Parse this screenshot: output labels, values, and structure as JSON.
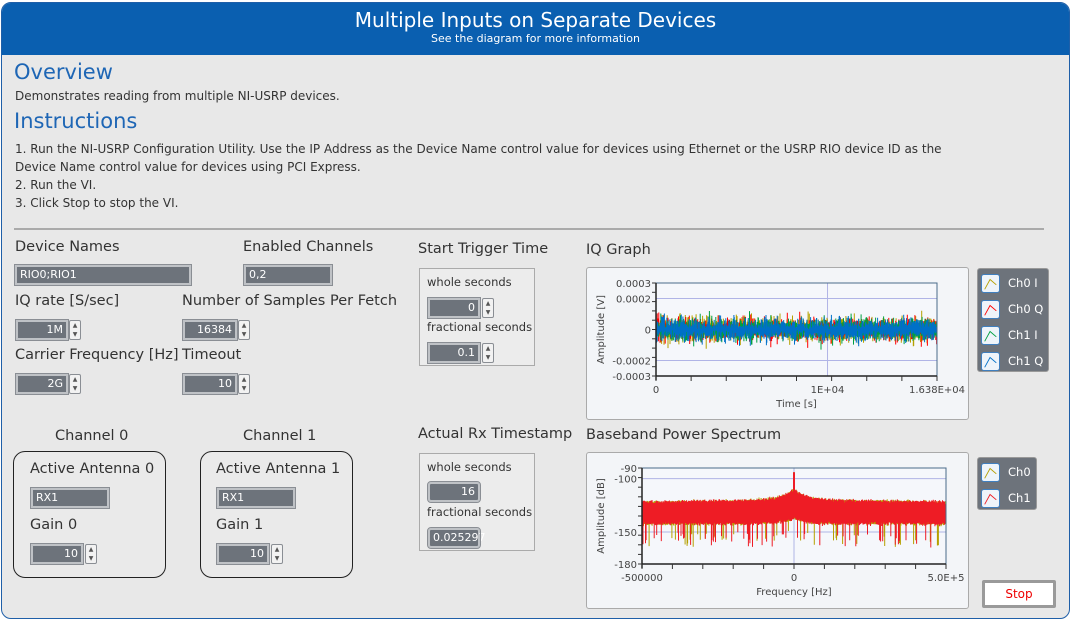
{
  "header": {
    "title": "Multiple Inputs on Separate Devices",
    "subtitle": "See the diagram for more information"
  },
  "overview": {
    "heading": "Overview",
    "text": "Demonstrates reading from multiple NI-USRP devices."
  },
  "instructions": {
    "heading": "Instructions",
    "lines": [
      "1. Run the NI-USRP Configuration Utility. Use the IP Address as the Device Name control value for devices using Ethernet or the USRP RIO device ID as the",
      "Device Name control value for devices using PCI Express.",
      "2. Run the VI.",
      "3. Click Stop to stop the VI."
    ]
  },
  "controls": {
    "device_names": {
      "label": "Device Names",
      "value": "RIO0;RIO1"
    },
    "enabled_channels": {
      "label": "Enabled Channels",
      "value": "0,2"
    },
    "iq_rate": {
      "label": "IQ rate [S/sec]",
      "value": "1M"
    },
    "samples_per_fetch": {
      "label": "Number of Samples Per Fetch",
      "value": "16384"
    },
    "carrier_frequency": {
      "label": "Carrier Frequency [Hz]",
      "value": "2G"
    },
    "timeout": {
      "label": "Timeout",
      "value": "10"
    }
  },
  "channels": [
    {
      "title": "Channel 0",
      "antenna_label": "Active Antenna 0",
      "antenna": "RX1",
      "gain_label": "Gain 0",
      "gain": "10"
    },
    {
      "title": "Channel 1",
      "antenna_label": "Active Antenna 1",
      "antenna": "RX1",
      "gain_label": "Gain 1",
      "gain": "10"
    }
  ],
  "start_trigger": {
    "label": "Start Trigger Time",
    "whole_label": "whole seconds",
    "whole": "0",
    "frac_label": "fractional seconds",
    "frac": "0.1"
  },
  "rx_timestamp": {
    "label": "Actual Rx Timestamp",
    "whole_label": "whole seconds",
    "whole": "16",
    "frac_label": "fractional seconds",
    "frac": "0.025297"
  },
  "stop_label": "Stop",
  "chart_data": [
    {
      "type": "line",
      "title": "IQ Graph",
      "xlabel": "Time [s]",
      "ylabel": "Amplitude [V]",
      "xlim": [
        0,
        16383
      ],
      "ylim": [
        -0.0003,
        0.0003
      ],
      "xticks": [
        "0",
        "1E+04",
        "1.638E+04"
      ],
      "yticks": [
        "0.0003",
        "0.0002",
        "0",
        "-0.0002",
        "-0.0003"
      ],
      "grid": true,
      "legend": "right",
      "series": [
        {
          "name": "Ch0 I",
          "color": "#b5a000"
        },
        {
          "name": "Ch0 Q",
          "color": "#ff0000"
        },
        {
          "name": "Ch1 I",
          "color": "#00a040"
        },
        {
          "name": "Ch1 Q",
          "color": "#0070c8"
        }
      ]
    },
    {
      "type": "line",
      "title": "Baseband Power Spectrum",
      "xlabel": "Frequency [Hz]",
      "ylabel": "Amplitude [dB]",
      "xlim": [
        -500000,
        500000
      ],
      "ylim": [
        -180,
        -90
      ],
      "xticks": [
        "-500000",
        "0",
        "5.0E+5"
      ],
      "yticks": [
        "-90",
        "-100",
        "-150",
        "-180"
      ],
      "grid": true,
      "legend": "right",
      "series": [
        {
          "name": "Ch0",
          "color": "#b5a000"
        },
        {
          "name": "Ch1",
          "color": "#ee1c25"
        }
      ]
    }
  ]
}
